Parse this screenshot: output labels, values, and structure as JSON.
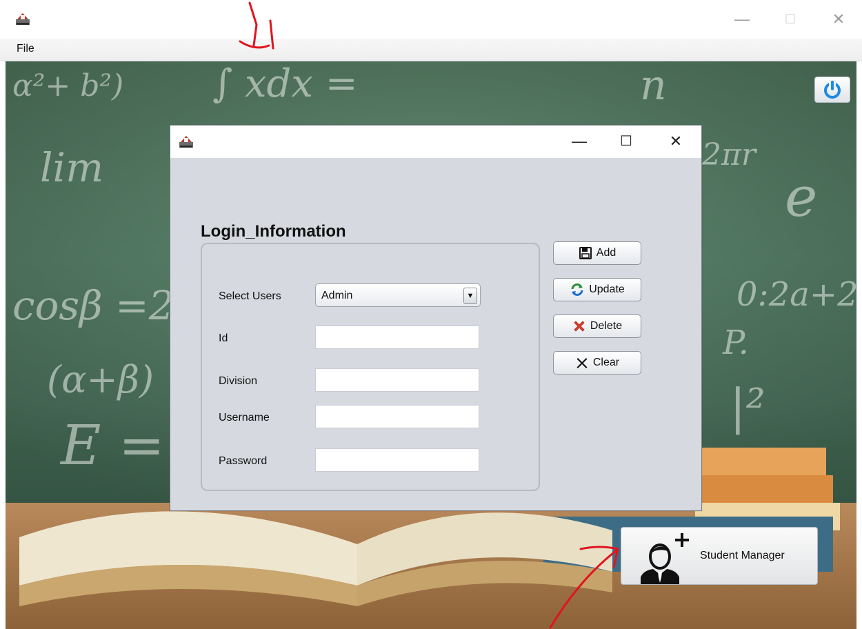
{
  "window": {
    "menu": [
      "File"
    ],
    "controls": {
      "minimize": "—",
      "maximize": "☐",
      "close": "✕"
    }
  },
  "dialog": {
    "controls": {
      "minimize": "—",
      "maximize": "☐",
      "close": "✕"
    },
    "section_title": "Login_Information",
    "form": {
      "select_users_label": "Select Users",
      "select_users_value": "Admin",
      "id_label": "Id",
      "id_value": "",
      "division_label": "Division",
      "division_value": "",
      "username_label": "Username",
      "username_value": "",
      "password_label": "Password",
      "password_value": ""
    },
    "buttons": {
      "add": "Add",
      "update": "Update",
      "delete": "Delete",
      "clear": "Clear"
    }
  },
  "student_manager": {
    "label": "Student Manager"
  },
  "icons": [
    "app-icon",
    "power-icon",
    "floppy-icon",
    "refresh-icon",
    "delete-x-icon",
    "clear-x-icon",
    "add-user-icon"
  ],
  "colors": {
    "annotation_red": "#e0141e",
    "power_blue": "#1e8be0"
  }
}
